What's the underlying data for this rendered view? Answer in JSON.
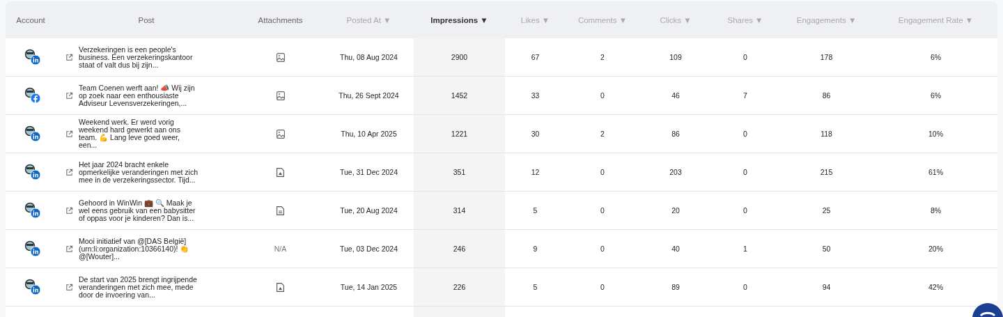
{
  "columns": [
    {
      "label": "Account",
      "selected": false
    },
    {
      "label": "Post",
      "selected": false
    },
    {
      "label": "Attachments",
      "selected": false
    },
    {
      "label": "Posted At",
      "arrow": "▼",
      "selected": false
    },
    {
      "label": "Impressions",
      "arrow": "▼",
      "selected": true
    },
    {
      "label": "Likes",
      "arrow": "▼",
      "selected": false
    },
    {
      "label": "Comments",
      "arrow": "▼",
      "selected": false
    },
    {
      "label": "Clicks",
      "arrow": "▼",
      "selected": false
    },
    {
      "label": "Shares",
      "arrow": "▼",
      "selected": false
    },
    {
      "label": "Engagements",
      "arrow": "▼",
      "selected": false
    },
    {
      "label": "Engagement Rate",
      "arrow": "▼",
      "selected": false
    }
  ],
  "rows": [
    {
      "account": {
        "kind": "linkedin"
      },
      "post": "Verzekeringen is een people's business. Een verzekeringskantoor staat of valt dus bij zijn...",
      "attachment": {
        "kind": "image"
      },
      "posted_at": "Thu, 08 Aug 2024",
      "impressions": "2900",
      "likes": "67",
      "comments": "2",
      "clicks": "109",
      "shares": "0",
      "engagements": "178",
      "engagement_rate": "6%"
    },
    {
      "account": {
        "kind": "facebook"
      },
      "post": "Team Coenen werft aan! 📣 Wij zijn op zoek naar een enthousiaste Adviseur Levensverzekeringen,...",
      "attachment": {
        "kind": "image"
      },
      "posted_at": "Thu, 26 Sept 2024",
      "impressions": "1452",
      "likes": "33",
      "comments": "0",
      "clicks": "46",
      "shares": "7",
      "engagements": "86",
      "engagement_rate": "6%"
    },
    {
      "account": {
        "kind": "linkedin"
      },
      "post": "Weekend werk. Er werd vorig weekend hard gewerkt aan ons team. 💪 Lang leve goed weer, een...",
      "attachment": {
        "kind": "image"
      },
      "posted_at": "Thu, 10 Apr 2025",
      "impressions": "1221",
      "likes": "30",
      "comments": "2",
      "clicks": "86",
      "shares": "0",
      "engagements": "118",
      "engagement_rate": "10%"
    },
    {
      "account": {
        "kind": "linkedin"
      },
      "post": "Het jaar 2024 bracht enkele opmerkelijke veranderingen met zich mee in de verzekeringssector. Tijd...",
      "attachment": {
        "kind": "pdf"
      },
      "posted_at": "Tue, 31 Dec 2024",
      "impressions": "351",
      "likes": "12",
      "comments": "0",
      "clicks": "203",
      "shares": "0",
      "engagements": "215",
      "engagement_rate": "61%"
    },
    {
      "account": {
        "kind": "linkedin"
      },
      "post": "Gehoord in WinWin 💼 🔍 Maak je wel eens gebruik van een babysitter of oppas voor je kinderen? Dan is...",
      "attachment": {
        "kind": "document"
      },
      "posted_at": "Tue, 20 Aug 2024",
      "impressions": "314",
      "likes": "5",
      "comments": "0",
      "clicks": "20",
      "shares": "0",
      "engagements": "25",
      "engagement_rate": "8%"
    },
    {
      "account": {
        "kind": "linkedin"
      },
      "post": "Mooi initiatief van @[DAS België] (urn:li:organization:10366140)! 👏 @[Wouter]...",
      "attachment": {
        "kind": "none",
        "text": "N/A"
      },
      "posted_at": "Tue, 03 Dec 2024",
      "impressions": "246",
      "likes": "9",
      "comments": "0",
      "clicks": "40",
      "shares": "1",
      "engagements": "50",
      "engagement_rate": "20%"
    },
    {
      "account": {
        "kind": "linkedin"
      },
      "post": "De start van 2025 brengt ingrijpende veranderingen met zich mee, mede door de invoering van...",
      "attachment": {
        "kind": "pdf"
      },
      "posted_at": "Tue, 14 Jan 2025",
      "impressions": "226",
      "likes": "5",
      "comments": "0",
      "clicks": "89",
      "shares": "0",
      "engagements": "94",
      "engagement_rate": "42%"
    }
  ]
}
